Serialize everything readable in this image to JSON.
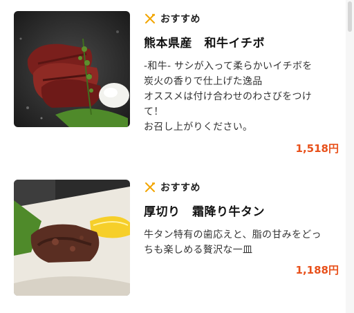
{
  "menu": {
    "items": [
      {
        "badge": "おすすめ",
        "name": "熊本県産　和牛イチボ",
        "description": "-和牛- サシが入って柔らかいイチボを\n炭火の香りで仕上げた逸品\nオススメは付け合わせのわさびをつけ\nて！\nお召し上がりください。",
        "price": "1,518円",
        "image": "grilled-wagyu-ichibo-photo"
      },
      {
        "badge": "おすすめ",
        "name": "厚切り　霜降り牛タン",
        "description": "牛タン特有の歯応えと、脂の甘みをどっ\nちも楽しめる贅沢な一皿",
        "price": "1,188円",
        "image": "thick-cut-beef-tongue-photo"
      }
    ]
  },
  "colors": {
    "price": "#e8501a",
    "badge_icon": "#f2a500"
  },
  "icons": {
    "badge": "fork-knife-icon"
  }
}
